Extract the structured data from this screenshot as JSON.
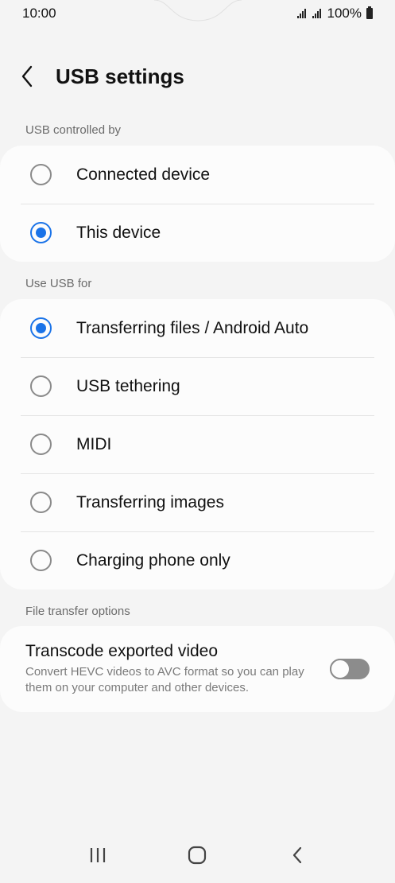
{
  "status_bar": {
    "time": "10:00",
    "battery": "100%"
  },
  "header": {
    "title": "USB settings"
  },
  "usb_controlled_by": {
    "label": "USB controlled by",
    "options": [
      {
        "label": "Connected device",
        "checked": false
      },
      {
        "label": "This device",
        "checked": true
      }
    ]
  },
  "use_usb_for": {
    "label": "Use USB for",
    "options": [
      {
        "label": "Transferring files / Android Auto",
        "checked": true
      },
      {
        "label": "USB tethering",
        "checked": false
      },
      {
        "label": "MIDI",
        "checked": false
      },
      {
        "label": "Transferring images",
        "checked": false
      },
      {
        "label": "Charging phone only",
        "checked": false
      }
    ]
  },
  "file_transfer_options": {
    "label": "File transfer options",
    "transcode": {
      "title": "Transcode exported video",
      "subtitle": "Convert HEVC videos to AVC format so you can play them on your computer and other devices.",
      "enabled": false
    }
  },
  "nav": {
    "recents_icon": "recents-icon",
    "home_icon": "home-icon",
    "back_icon": "back-icon"
  },
  "colors": {
    "accent": "#1a73e8",
    "background": "#f4f4f4",
    "card": "#fcfcfc"
  }
}
